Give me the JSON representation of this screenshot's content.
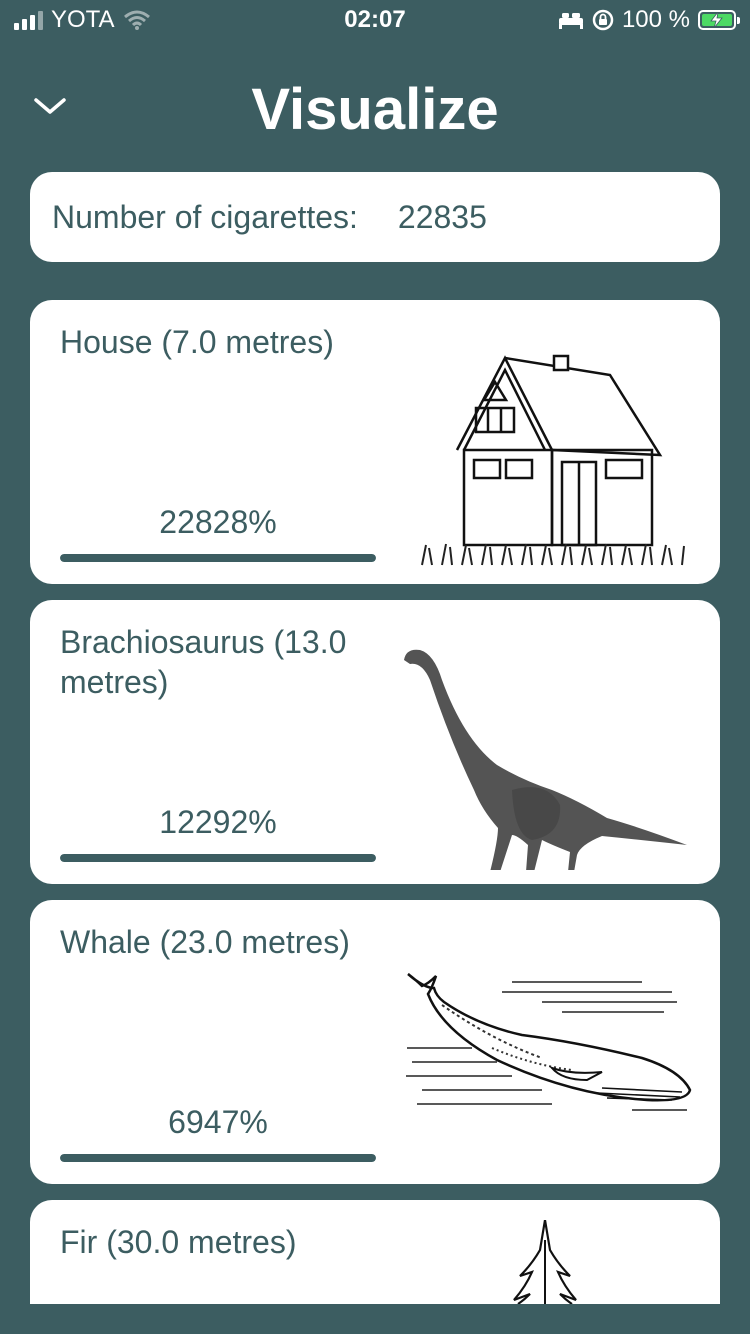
{
  "status_bar": {
    "carrier": "YOTA",
    "time": "02:07",
    "battery": "100 %"
  },
  "header": {
    "title": "Visualize"
  },
  "count": {
    "label": "Number of cigarettes:",
    "value": "22835"
  },
  "items": [
    {
      "name": "House (7.0 metres)",
      "percent": "22828%",
      "progress": 1.0,
      "icon": "house-icon"
    },
    {
      "name": "Brachiosaurus (13.0 metres)",
      "percent": "12292%",
      "progress": 1.0,
      "icon": "brachiosaurus-icon"
    },
    {
      "name": "Whale (23.0 metres)",
      "percent": "6947%",
      "progress": 1.0,
      "icon": "whale-icon"
    },
    {
      "name": "Fir (30.0 metres)",
      "icon": "fir-tree-icon"
    }
  ],
  "colors": {
    "background": "#3c5d61",
    "card": "#ffffff",
    "accent": "#3c5d61",
    "battery": "#4cd964"
  }
}
